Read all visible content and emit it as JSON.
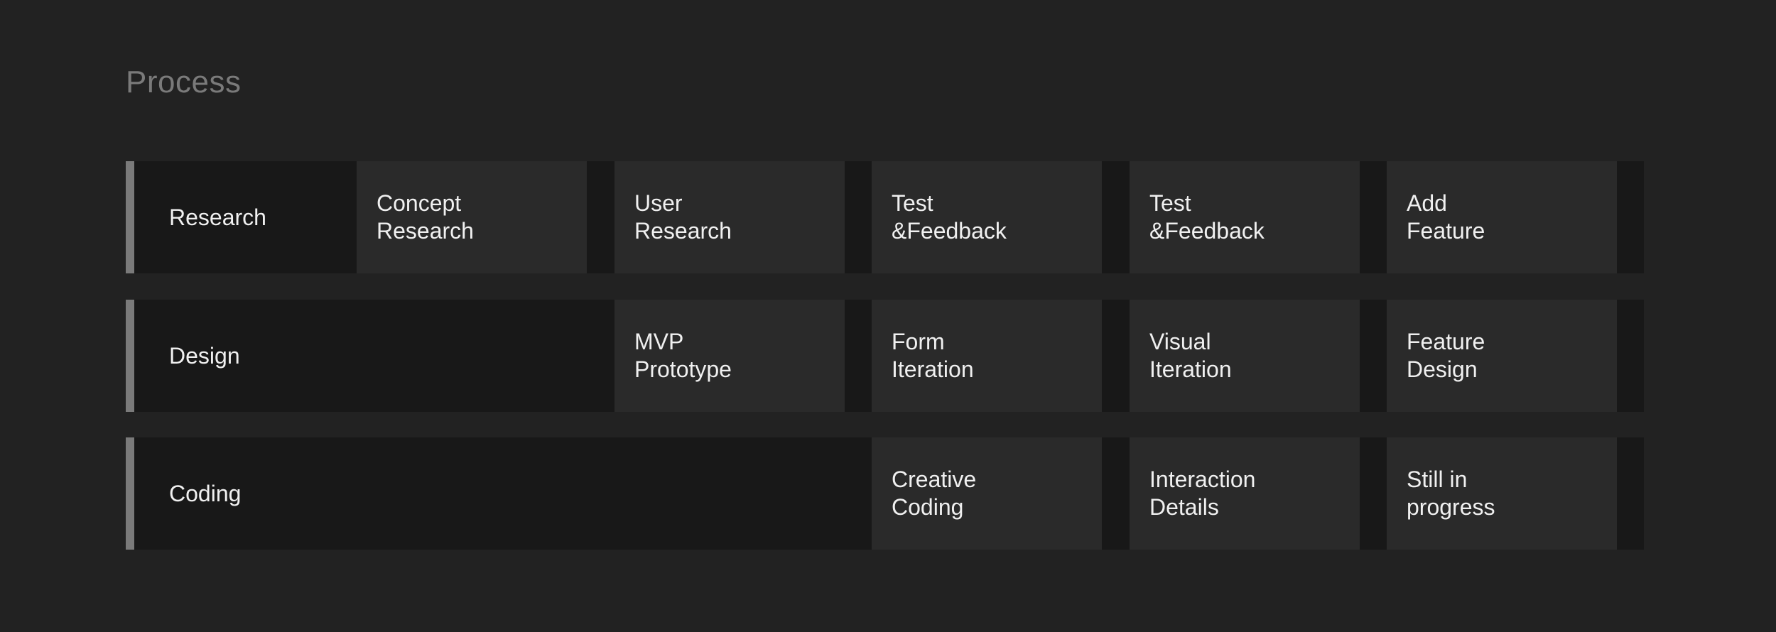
{
  "title": "Process",
  "rows": [
    {
      "label": "Research",
      "cells": [
        {
          "line1": "Concept",
          "line2": "Research"
        },
        {
          "line1": "User",
          "line2": "Research"
        },
        {
          "line1": "Test",
          "line2": "&Feedback"
        },
        {
          "line1": "Test",
          "line2": "&Feedback"
        },
        {
          "line1": "Add",
          "line2": "Feature"
        }
      ]
    },
    {
      "label": "Design",
      "cells": [
        {
          "line1": "MVP",
          "line2": "Prototype"
        },
        {
          "line1": "Form",
          "line2": "Iteration"
        },
        {
          "line1": "Visual",
          "line2": "Iteration"
        },
        {
          "line1": "Feature",
          "line2": "Design"
        }
      ]
    },
    {
      "label": "Coding",
      "cells": [
        {
          "line1": "Creative",
          "line2": "Coding"
        },
        {
          "line1": "Interaction",
          "line2": "Details"
        },
        {
          "line1": "Still in",
          "line2": "progress"
        }
      ]
    }
  ],
  "colors": {
    "background": "#222222",
    "row_background": "#181818",
    "cell_background": "#2a2a2a",
    "accent_bar": "#7a7a7a",
    "title_text": "#7a7a7a",
    "text": "#f0f0f0"
  }
}
